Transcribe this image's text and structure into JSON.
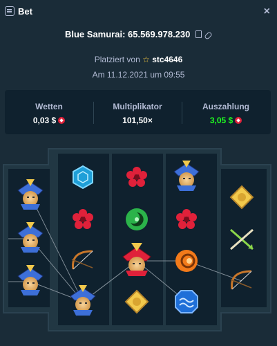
{
  "header": {
    "title": "Bet",
    "close_glyph": "×",
    "icon": "bet-slip-icon"
  },
  "game": {
    "name_and_id": "Blue Samurai: 65.569.978.230",
    "icons": [
      "copy-icon",
      "link-icon"
    ]
  },
  "placed": {
    "prefix": "Platziert von",
    "user": "stc4646"
  },
  "date": "Am 11.12.2021 um 09:55",
  "stats": {
    "bet_label": "Wetten",
    "bet_value": "0,03 $",
    "multiplier_label": "Multiplikator",
    "multiplier_value": "101,50×",
    "payout_label": "Auszahlung",
    "payout_value": "3,05 $"
  },
  "colors": {
    "bg": "#1a2c38",
    "panel": "#0f212e",
    "payout": "#1fff20",
    "gem": "#e0213a"
  },
  "reels": [
    [
      "samurai",
      "samurai",
      "samurai"
    ],
    [
      "blue-hexagon",
      "red-flower",
      "bow",
      "samurai"
    ],
    [
      "red-flower",
      "green-swirl",
      "red-samurai",
      "gold-emblem"
    ],
    [
      "samurai",
      "red-flower",
      "orange-orb",
      "blue-wave"
    ],
    [
      "gold-emblem",
      "crossed-arrows",
      "bow"
    ]
  ]
}
